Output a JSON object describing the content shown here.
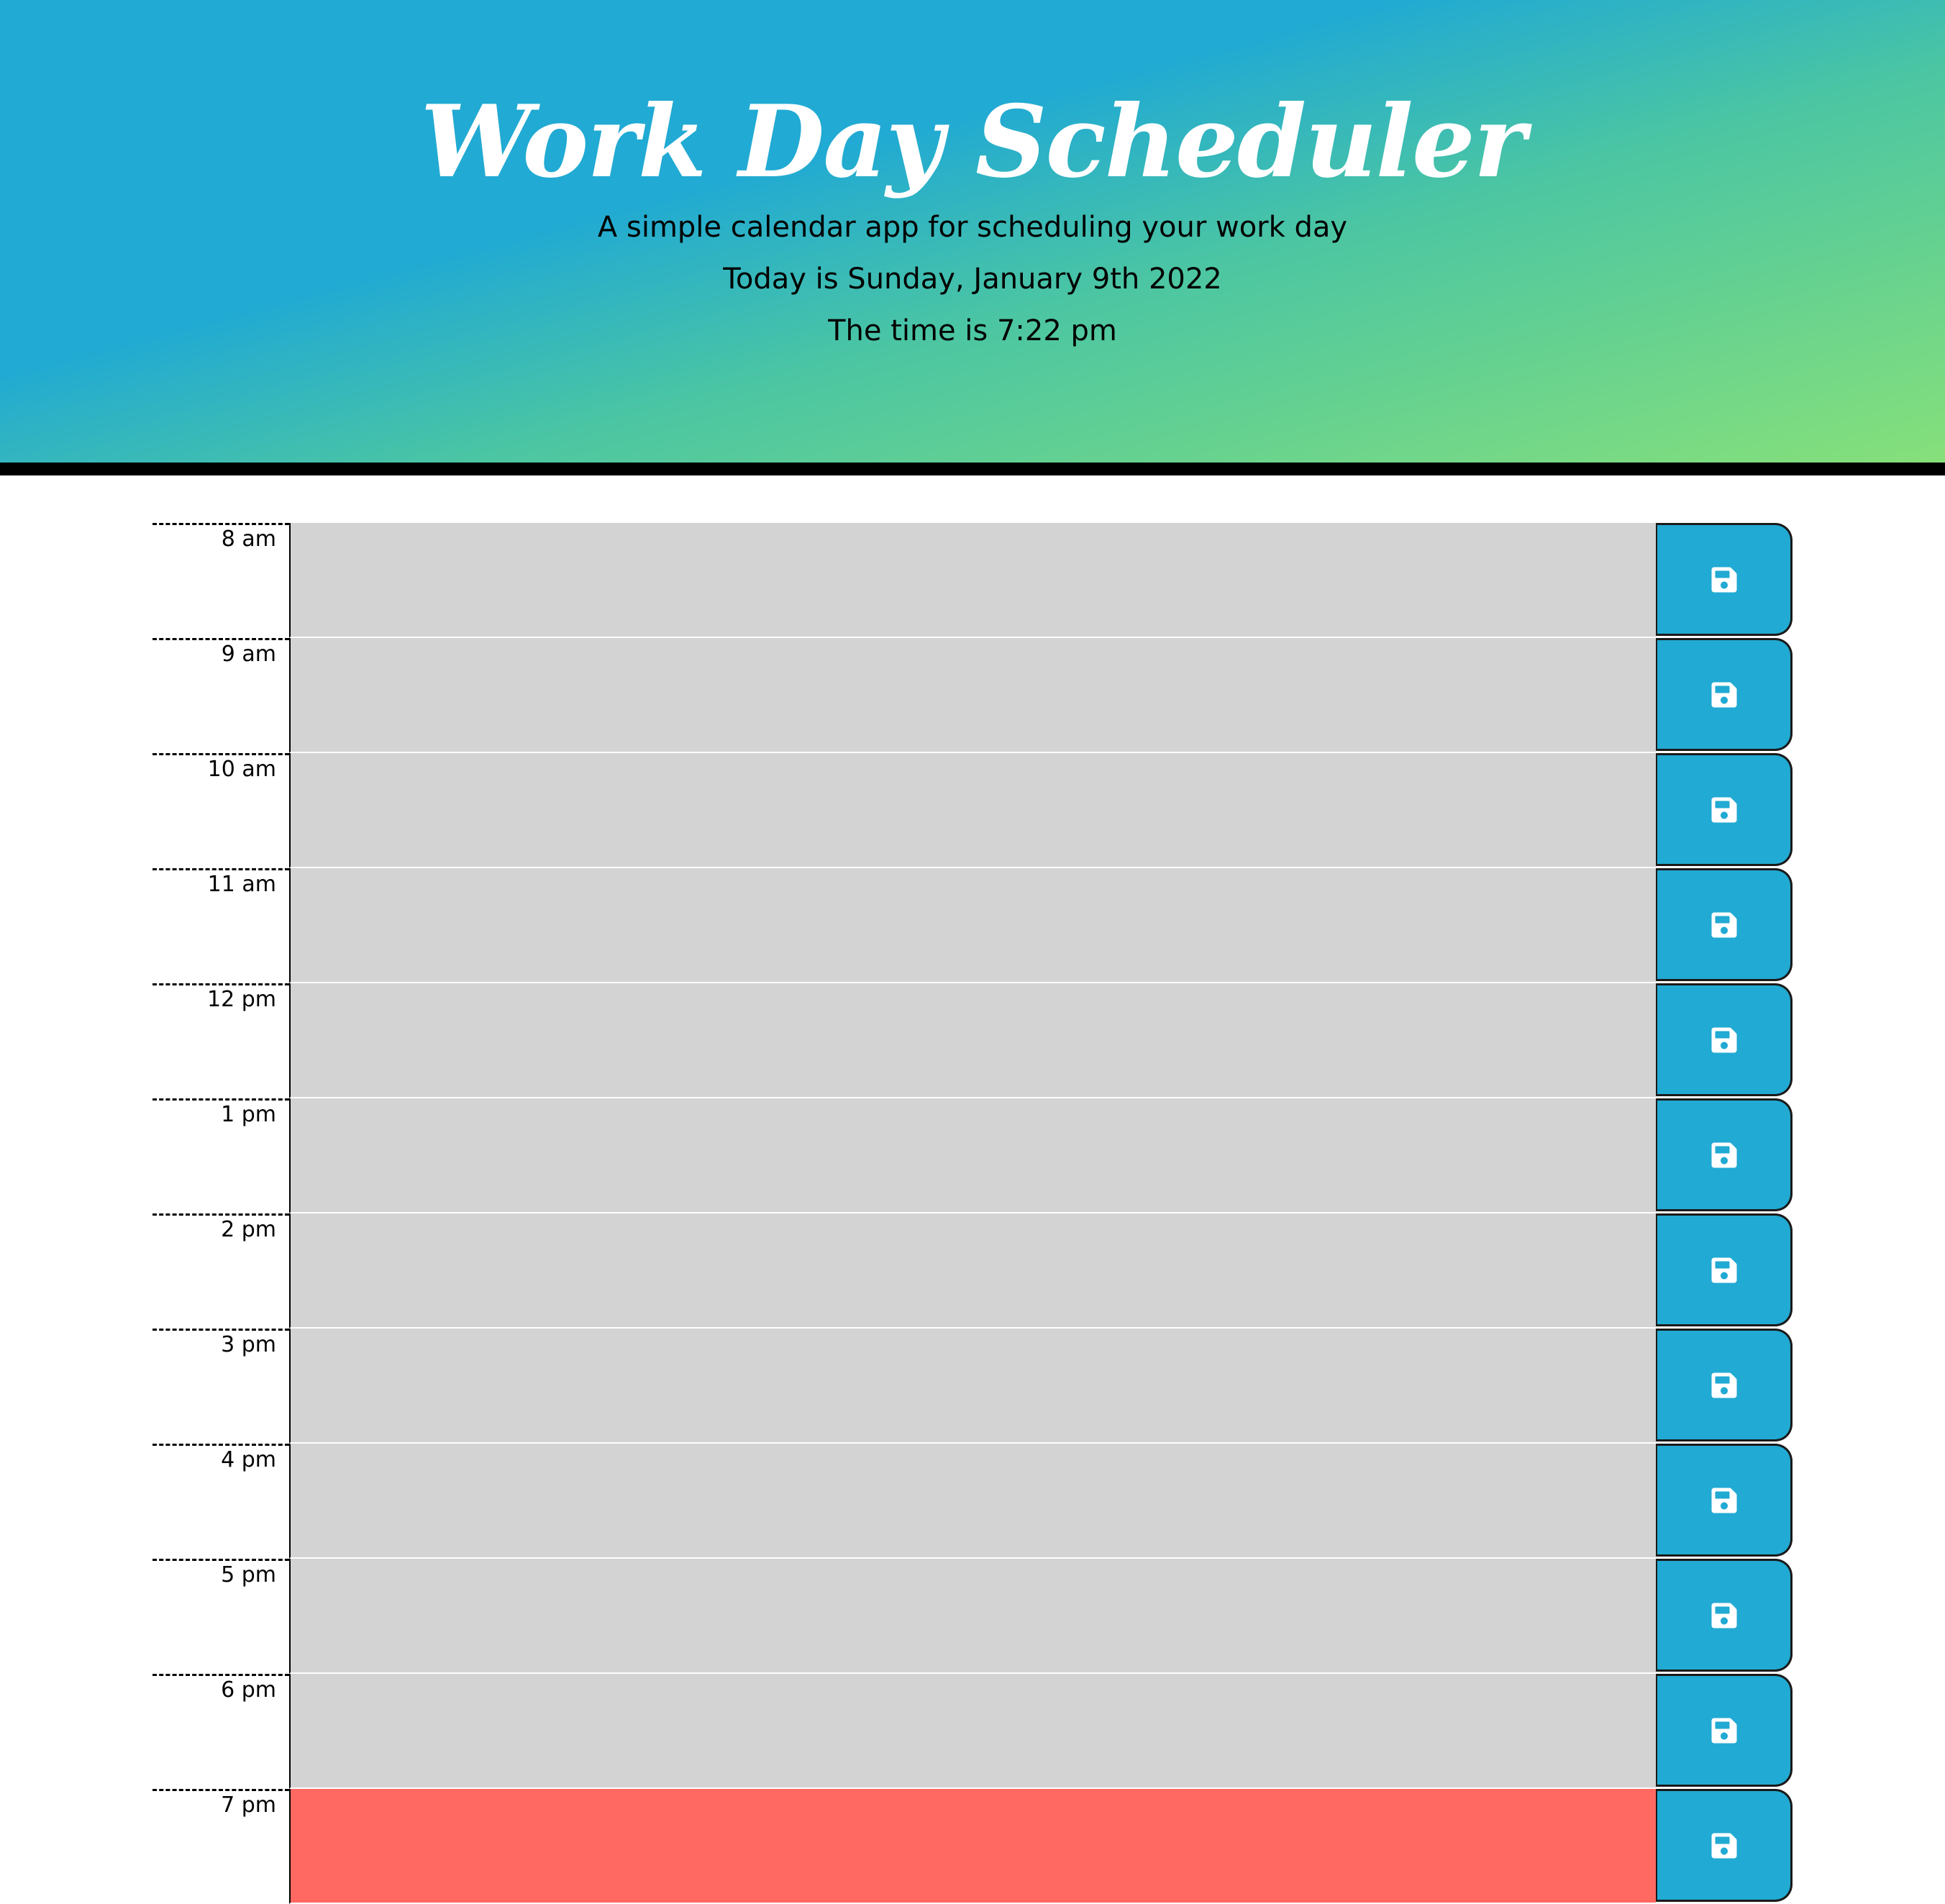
{
  "header": {
    "title": "Work Day Scheduler",
    "subtitle": "A simple calendar app for scheduling your work day",
    "date_text": "Today is Sunday, January 9th 2022",
    "time_text": "The time is 7:22 pm"
  },
  "colors": {
    "header_gradient_start": "#21aad3",
    "header_gradient_end": "#86e07a",
    "past": "#d3d3d3",
    "present": "#ff6961",
    "future": "#77dd77",
    "save_button": "#21aad3",
    "save_icon": "#ffffff"
  },
  "save_icon_name": "floppy-disk-icon",
  "time_blocks": [
    {
      "hour": "8 am",
      "status": "past",
      "text": ""
    },
    {
      "hour": "9 am",
      "status": "past",
      "text": ""
    },
    {
      "hour": "10 am",
      "status": "past",
      "text": ""
    },
    {
      "hour": "11 am",
      "status": "past",
      "text": ""
    },
    {
      "hour": "12 pm",
      "status": "past",
      "text": ""
    },
    {
      "hour": "1 pm",
      "status": "past",
      "text": ""
    },
    {
      "hour": "2 pm",
      "status": "past",
      "text": ""
    },
    {
      "hour": "3 pm",
      "status": "past",
      "text": ""
    },
    {
      "hour": "4 pm",
      "status": "past",
      "text": ""
    },
    {
      "hour": "5 pm",
      "status": "past",
      "text": ""
    },
    {
      "hour": "6 pm",
      "status": "past",
      "text": ""
    },
    {
      "hour": "7 pm",
      "status": "present",
      "text": ""
    }
  ]
}
